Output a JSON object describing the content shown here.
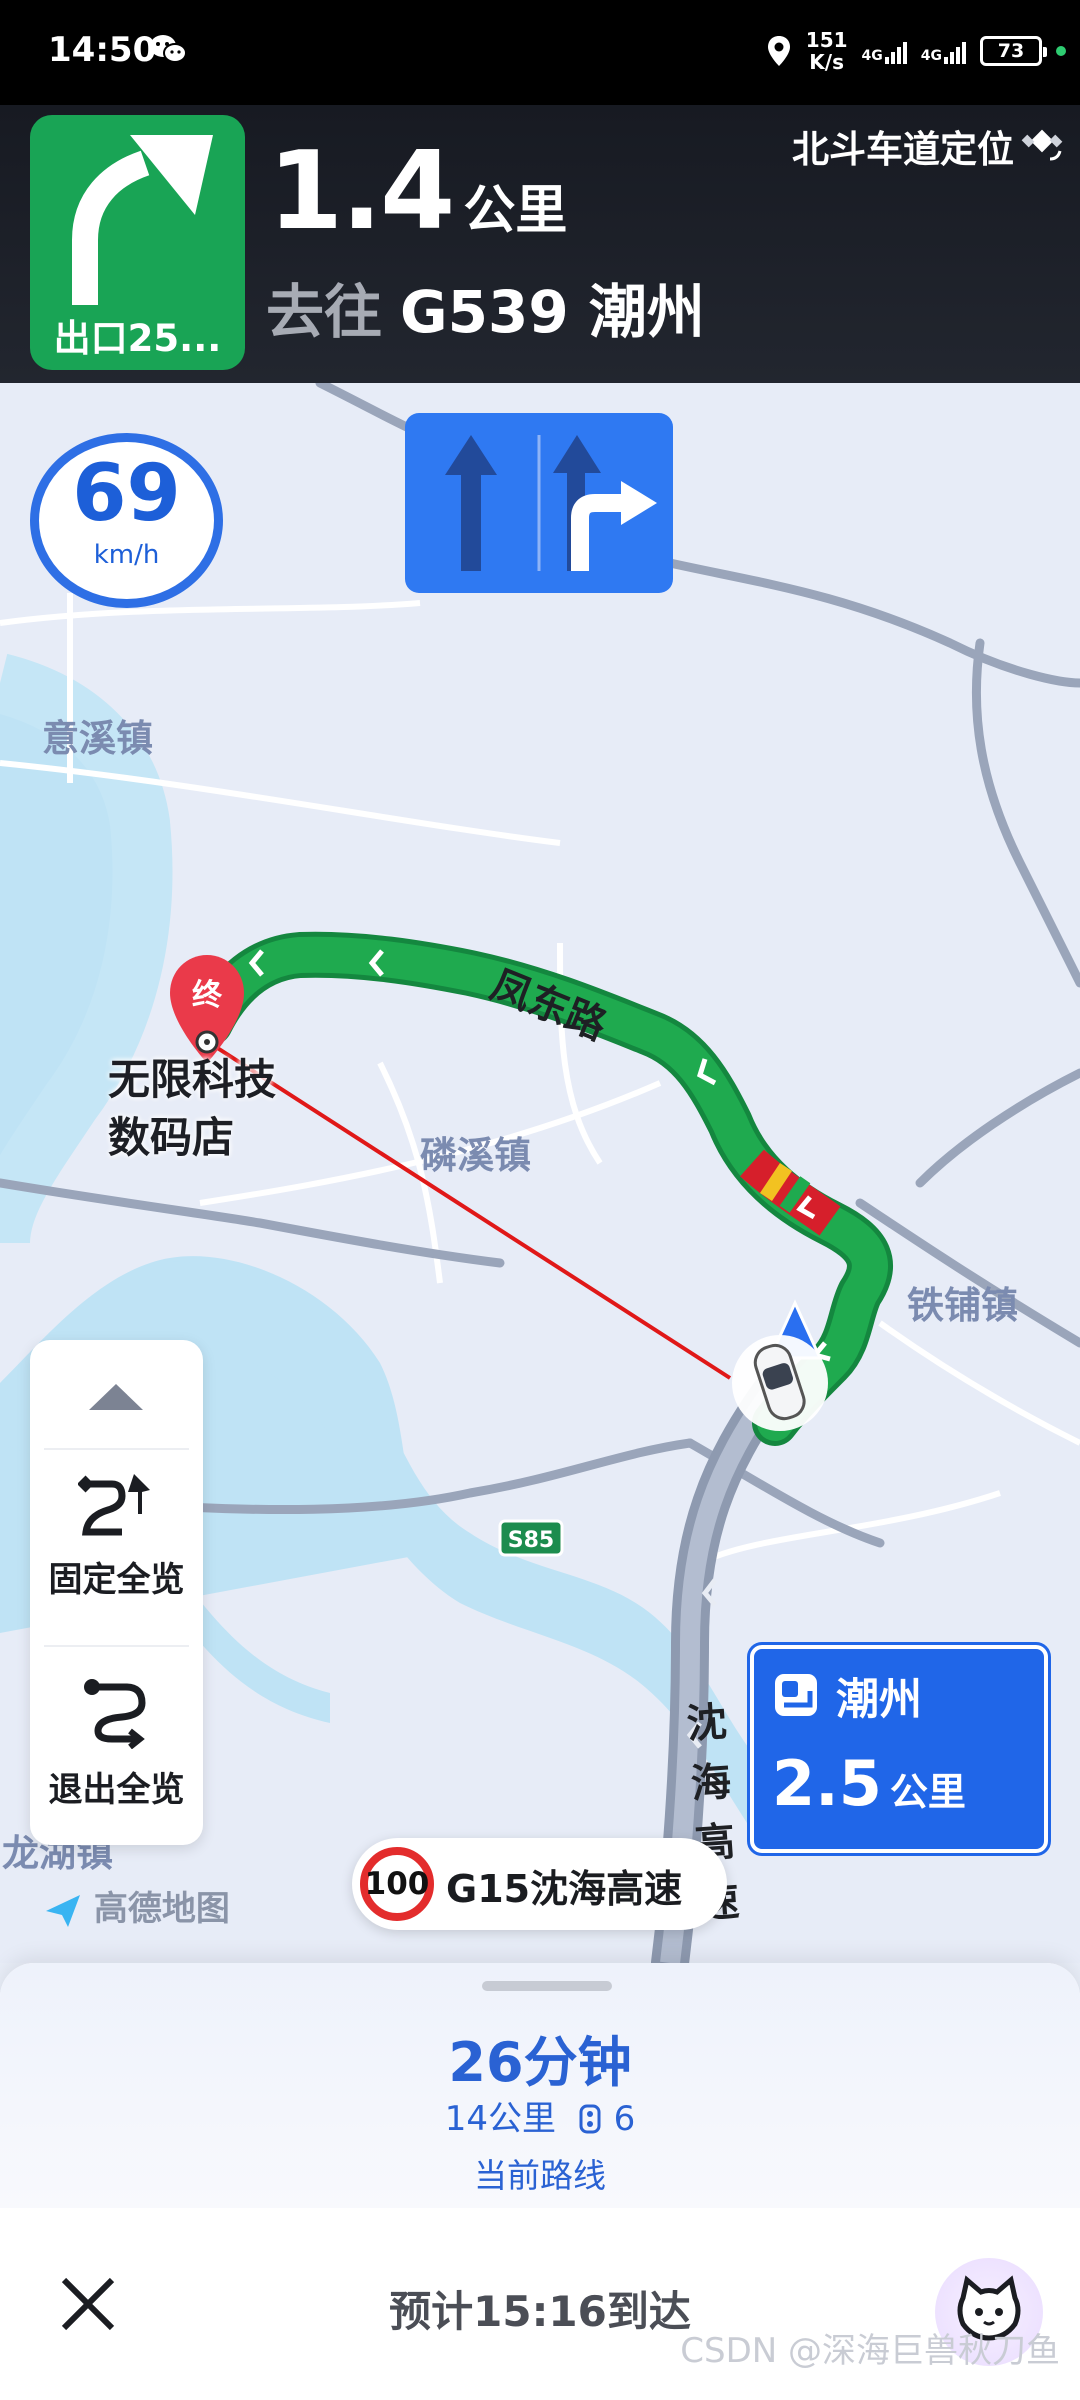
{
  "status_bar": {
    "time": "14:50",
    "net_speed_value": "151",
    "net_speed_unit": "K/s",
    "signal_1": "4G",
    "signal_2": "4G",
    "battery": "73"
  },
  "guidance": {
    "exit_label": "出口25...",
    "distance_value": "1.4",
    "distance_unit": "公里",
    "toward_prefix": "去往",
    "toward_road": "G539 潮州",
    "positioning_label": "北斗车道定位"
  },
  "map": {
    "current_speed": "69",
    "speed_unit": "km/h",
    "places": [
      "意溪镇",
      "磷溪镇",
      "铁铺镇",
      "龙湖镇"
    ],
    "destination_marker": "终",
    "destination_name_line1": "无限科技",
    "destination_name_line2": "数码店",
    "road_fengdong": "凤东路",
    "road_shenhai_vertical": "沈海高速",
    "highway_shield": "S85",
    "map_logo": "高德地图",
    "controls": {
      "fixed_overview": "固定全览",
      "exit_overview": "退出全览"
    },
    "direction_sign": {
      "city": "潮州",
      "distance_value": "2.5",
      "distance_unit": "公里"
    },
    "current_road": {
      "speed_limit": "100",
      "name": "G15沈海高速"
    }
  },
  "bottom_panel": {
    "eta_duration": "26分钟",
    "eta_distance": "14公里",
    "traffic_lights": "6",
    "route_label": "当前路线",
    "arrival": "预计15:16到达",
    "watermark": "CSDN @深海巨兽秋刀鱼"
  },
  "colors": {
    "turn_green": "#19a455",
    "lane_blue": "#2f79f2",
    "accent_blue": "#2a62d3",
    "route_green": "#1faa4f"
  }
}
